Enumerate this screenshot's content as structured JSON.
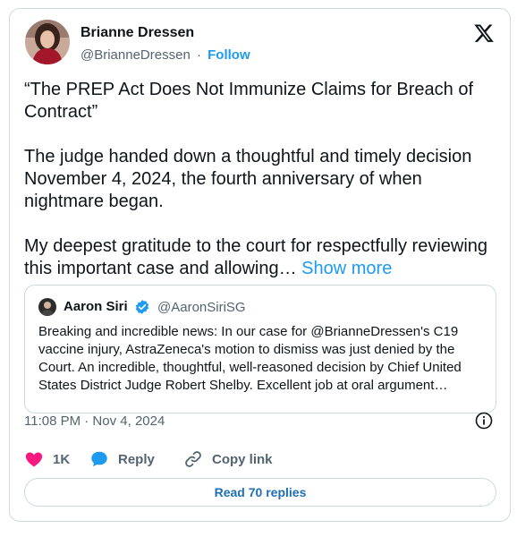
{
  "author": {
    "name": "Brianne Dressen",
    "handle": "@BrianneDressen",
    "separator": "·",
    "follow_label": "Follow"
  },
  "tweet": {
    "paragraphs": [
      "“The PREP Act Does Not Immunize Claims for Breach of Contract”",
      "The judge handed down a thoughtful and timely decision November 4, 2024, the fourth anniversary of when nightmare began.",
      "My deepest gratitude to the court for respectfully reviewing this important case and allowing…"
    ],
    "show_more_label": "Show more"
  },
  "quote": {
    "name": "Aaron Siri",
    "handle": "@AaronSiriSG",
    "text": "Breaking and incredible news: In our case for @BrianneDressen's C19 vaccine injury, AstraZeneca's motion to dismiss was just denied by the Court. An incredible, thoughtful, well-reasoned decision by Chief United States District Judge Robert Shelby. Excellent job at oral argument…"
  },
  "timestamp": "11:08 PM · Nov 4, 2024",
  "actions": {
    "like_count": "1K",
    "reply_label": "Reply",
    "copy_link_label": "Copy link"
  },
  "read_replies_label": "Read 70 replies",
  "colors": {
    "accent": "#1d9bf0",
    "like": "#f91880",
    "verified": "#1d9bf0",
    "muted_text": "#536471",
    "border": "#cfd9de"
  }
}
